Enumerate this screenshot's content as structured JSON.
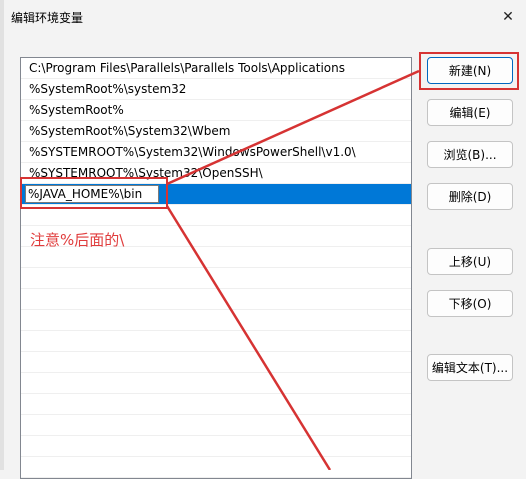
{
  "dialog": {
    "title": "编辑环境变量",
    "close_glyph": "✕"
  },
  "list": {
    "items": [
      "C:\\Program Files\\Parallels\\Parallels Tools\\Applications",
      "%SystemRoot%\\system32",
      "%SystemRoot%",
      "%SystemRoot%\\System32\\Wbem",
      "%SYSTEMROOT%\\System32\\WindowsPowerShell\\v1.0\\",
      "%SYSTEMROOT%\\System32\\OpenSSH\\"
    ],
    "editing_value": "%JAVA_HOME%\\bin"
  },
  "buttons": {
    "new": "新建(N)",
    "edit": "编辑(E)",
    "browse": "浏览(B)...",
    "delete": "删除(D)",
    "move_up": "上移(U)",
    "move_down": "下移(O)",
    "edit_text": "编辑文本(T)..."
  },
  "annotation": {
    "text": "注意%后面的\\",
    "color": "#d63333"
  },
  "colors": {
    "selection": "#0078d7",
    "accent_border": "#0067c0"
  }
}
